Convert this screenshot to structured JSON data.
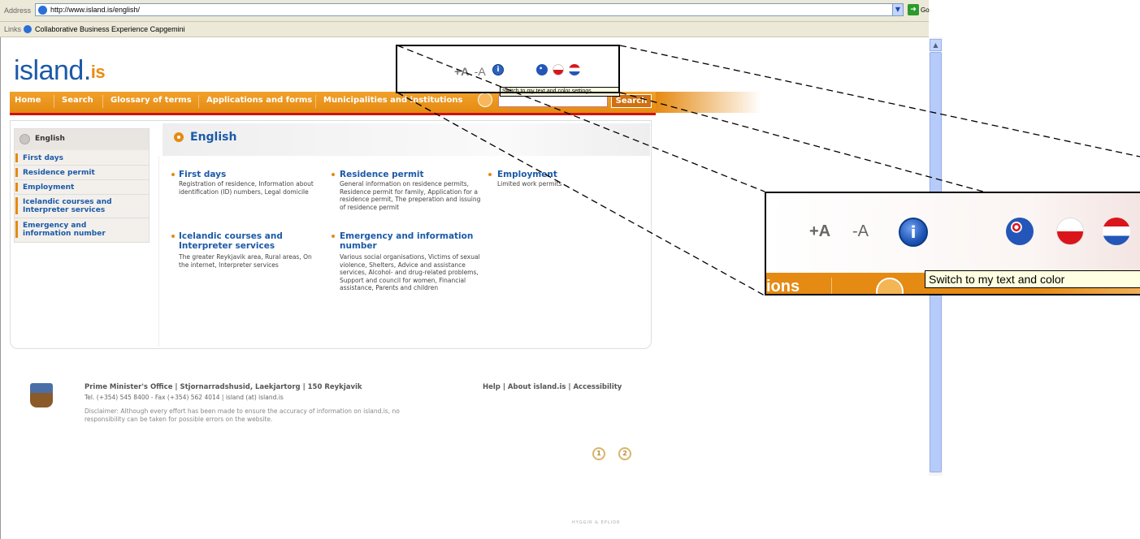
{
  "browser": {
    "address_label": "Address",
    "url": "http://www.island.is/english/",
    "go_label": "Go",
    "links_label": "Links",
    "link_item": "Collaborative Business Experience Capgemini"
  },
  "site": {
    "logo_text": "island.",
    "logo_suffix": "is",
    "text_increase": "+A",
    "text_decrease": "-A",
    "tooltip": "Switch to my text and color settings"
  },
  "nav": {
    "items": [
      "Home",
      "Search",
      "Glossary of terms",
      "Applications and forms",
      "Municipalities and institutions"
    ],
    "search_button": "Search"
  },
  "sidebar": {
    "header": "English",
    "items": [
      "First days",
      "Residence permit",
      "Employment",
      "Icelandic courses and Interpreter services",
      "Emergency and information number"
    ]
  },
  "main": {
    "title": "English",
    "sections": [
      {
        "title": "First days",
        "text": "Registration of residence, Information about identification (ID) numbers, Legal domicile"
      },
      {
        "title": "Residence permit",
        "text": "General information on residence permits, Residence permit for family, Application for a residence permit, The preperation and issuing of residence permit"
      },
      {
        "title": "Employment",
        "text": "Limited work permits"
      },
      {
        "title": "Icelandic courses and Interpreter services",
        "text": "The greater Reykjavik area, Rural areas, On the internet, Interpreter services"
      },
      {
        "title": "Emergency and information number",
        "text": "Various social organisations, Victims of sexual violence, Shelters, Advice and assistance services, Alcohol- and drug-related problems, Support and council for women, Financial assistance, Parents and children"
      }
    ]
  },
  "footer": {
    "address": "Prime Minister's Office  |  Stjornarradshusid, Laekjartorg  |  150 Reykjavik",
    "contact": "Tel. (+354) 545 8400 - Fax (+354) 562 4014  |  island (at) island.is",
    "disclaimer": "Disclaimer: Although every effort has been made to ensure the accuracy of information on island.is, no responsibility can be taken for possible errors on the website.",
    "links": "Help | About island.is | Accessibility",
    "wcag1": "1",
    "wcag2": "2",
    "credit": "HYGGIR & EPLIOR"
  },
  "zoom": {
    "nav_fragment": "ions",
    "tooltip": "Switch to my text and color"
  },
  "colors": {
    "brand_blue": "#1b5aa8",
    "brand_orange": "#e58a12",
    "accent_red": "#d01010"
  }
}
